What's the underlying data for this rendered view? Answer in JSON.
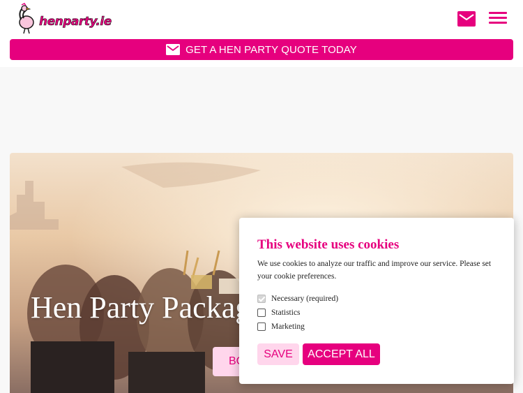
{
  "header": {
    "logo_text": "henparty.ie",
    "mail_icon": "mail-icon",
    "menu_icon": "hamburger-menu-icon"
  },
  "quote_bar": {
    "label": "GET A HEN PARTY QUOTE TODAY",
    "icon": "mail-icon"
  },
  "hero": {
    "title": "Hen Party Packag",
    "button_label": "BO"
  },
  "cookie_dialog": {
    "title": "This website uses cookies",
    "description": "We use cookies to analyze our traffic and improve our service. Please set your cookie preferences.",
    "options": [
      {
        "label": "Necessary (required)",
        "checked": true,
        "disabled": true
      },
      {
        "label": "Statistics",
        "checked": false,
        "disabled": false
      },
      {
        "label": "Marketing",
        "checked": false,
        "disabled": false
      }
    ],
    "save_label": "SAVE",
    "accept_all_label": "ACCEPT ALL"
  },
  "colors": {
    "brand_pink": "#e6007e",
    "light_pink": "#ffd6ec",
    "page_grey": "#f8f8f8"
  }
}
